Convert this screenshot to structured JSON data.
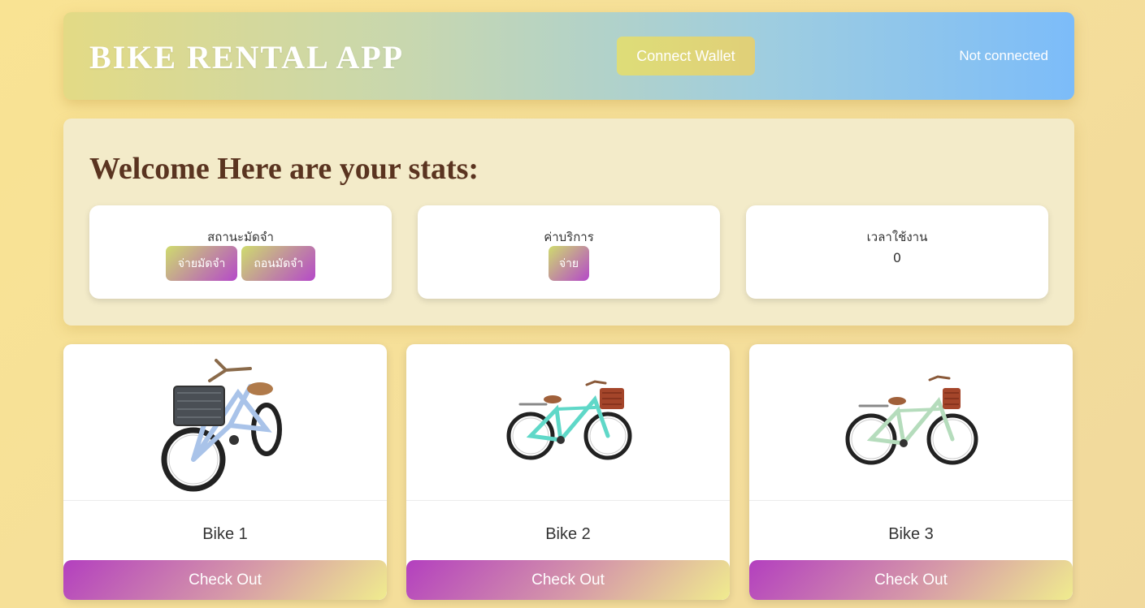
{
  "header": {
    "title": "BIKE RENTAL APP",
    "connect_button": "Connect Wallet",
    "wallet_status": "Not connected"
  },
  "stats": {
    "welcome": "Welcome Here are your stats:",
    "deposit": {
      "label": "สถานะมัดจำ",
      "pay_button": "จ่ายมัดจำ",
      "withdraw_button": "ถอนมัดจำ"
    },
    "fee": {
      "label": "ค่าบริการ",
      "pay_button": "จ่าย"
    },
    "usage": {
      "label": "เวลาใช้งาน",
      "value": "0"
    }
  },
  "bikes": [
    {
      "name": "Bike 1",
      "checkout": "Check Out",
      "frame_color": "#a9c3e9",
      "image": "bicycle-with-basket"
    },
    {
      "name": "Bike 2",
      "checkout": "Check Out",
      "frame_color": "#5fd8c8",
      "image": "bicycle-with-basket"
    },
    {
      "name": "Bike 3",
      "checkout": "Check Out",
      "frame_color": "#b5dcbc",
      "image": "bicycle-with-basket"
    }
  ],
  "colors": {
    "background": "#f7e196",
    "title_brown": "#5a3420",
    "button_purple": "#b549c9",
    "button_yellow": "#f0ec8e"
  }
}
